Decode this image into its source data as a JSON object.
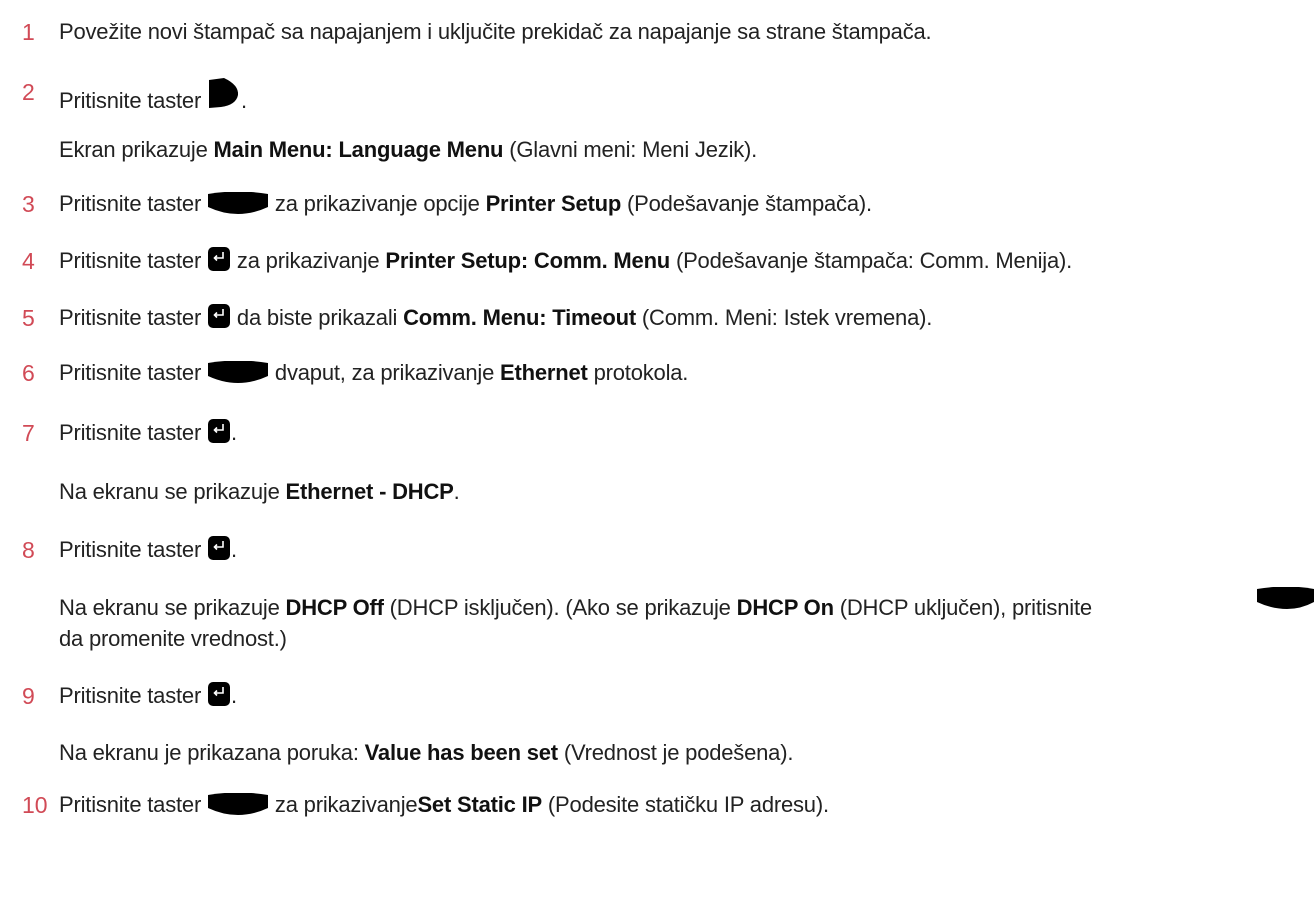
{
  "accent_color": "#d14a56",
  "steps": [
    {
      "num": "1",
      "a": "Povežite novi štampač sa napajanjem i uključite prekidač za napajanje sa strane štampača."
    },
    {
      "num": "2",
      "a": "Pritisnite taster",
      "b": ".",
      "note": {
        "a": "Ekran prikazuje ",
        "bold": "Main Menu: Language Menu",
        "b": " (Glavni meni: Meni Jezik)."
      }
    },
    {
      "num": "3",
      "a": "Pritisnite taster",
      "b": " za prikazivanje opcije ",
      "bold": "Printer Setup",
      "c": " (Podešavanje štampača)."
    },
    {
      "num": "4",
      "a": "Pritisnite taster",
      "b": " za prikazivanje ",
      "bold": "Printer Setup: Comm. Menu",
      "c": " (Podešavanje štampača: Comm. Menija)."
    },
    {
      "num": "5",
      "a": "Pritisnite taster",
      "b": " da biste prikazali ",
      "bold": "Comm. Menu: Timeout",
      "c": " (Comm. Meni: Istek vremena)."
    },
    {
      "num": "6",
      "a": "Pritisnite taster",
      "b": " dvaput, za prikazivanje ",
      "bold": "Ethernet",
      "c": " protokola."
    },
    {
      "num": "7",
      "a": "Pritisnite taster",
      "b": ".",
      "note": {
        "a": "Na ekranu se prikazuje ",
        "bold": "Ethernet - DHCP",
        "b": "."
      }
    },
    {
      "num": "8",
      "a": "Pritisnite taster",
      "b": ".",
      "note": {
        "a": "Na ekranu se prikazuje ",
        "bold": "DHCP Off",
        "b": " (DHCP isključen). (Ako se prikazuje ",
        "bold2": "DHCP On",
        "c": " (DHCP uključen), pritisnite",
        "line2": "da promenite vrednost.)"
      }
    },
    {
      "num": "9",
      "a": "Pritisnite taster",
      "b": ".",
      "note": {
        "a": "Na ekranu je prikazana poruka: ",
        "bold": "Value has been set",
        "b": " (Vrednost je podešena)."
      }
    },
    {
      "num": "10",
      "a": "Pritisnite taster",
      "b": " za prikazivanje",
      "bold": "Set Static IP",
      "c": " (Podesite statičku IP adresu)."
    }
  ],
  "icons": {
    "power_key": "power-key-icon",
    "down_key": "down-arrow-key-icon",
    "enter_key": "enter-key-icon"
  }
}
